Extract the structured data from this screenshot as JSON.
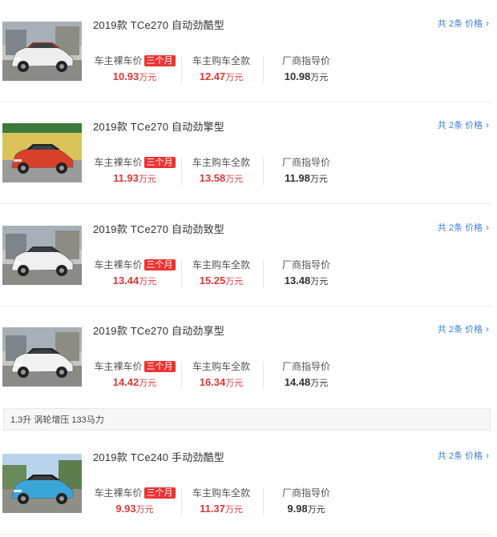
{
  "items": [
    {
      "title": "2019款 TCe270 自动劲酷型",
      "count": "共 2条 价格",
      "label_naked": "车主裸车价",
      "tag": "三个月",
      "naked": "10.93",
      "unit": "万元",
      "label_total": "车主购车全款",
      "total": "12.47",
      "label_guide": "厂商指导价",
      "guide": "10.98",
      "car_color": "#eeeeee",
      "roof_color": "#7a3a2a"
    },
    {
      "title": "2019款 TCe270 自动劲擎型",
      "count": "共 2条 价格",
      "label_naked": "车主裸车价",
      "tag": "三个月",
      "naked": "11.93",
      "unit": "万元",
      "label_total": "车主购车全款",
      "total": "13.58",
      "label_guide": "厂商指导价",
      "guide": "11.98",
      "car_color": "#d8402a",
      "roof_color": "#222222"
    },
    {
      "title": "2019款 TCe270 自动劲致型",
      "count": "共 2条 价格",
      "label_naked": "车主裸车价",
      "tag": "三个月",
      "naked": "13.44",
      "unit": "万元",
      "label_total": "车主购车全款",
      "total": "15.25",
      "label_guide": "厂商指导价",
      "guide": "13.48",
      "car_color": "#f0f0f0",
      "roof_color": "#333333"
    },
    {
      "title": "2019款 TCe270 自动劲享型",
      "count": "共 2条 价格",
      "label_naked": "车主裸车价",
      "tag": "三个月",
      "naked": "14.42",
      "unit": "万元",
      "label_total": "车主购车全款",
      "total": "16.34",
      "label_guide": "厂商指导价",
      "guide": "14.48",
      "car_color": "#f2f2f2",
      "roof_color": "#2a2a2a"
    },
    {
      "title": "2019款 TCe240 手动劲酷型",
      "count": "共 2条 价格",
      "label_naked": "车主裸车价",
      "tag": "三个月",
      "naked": "9.93",
      "unit": "万元",
      "label_total": "车主购车全款",
      "total": "11.37",
      "label_guide": "厂商指导价",
      "guide": "9.98",
      "car_color": "#3aa6d8",
      "roof_color": "#1e1e1e"
    }
  ],
  "spec_bar": "1.3升 涡轮增压 133马力",
  "colors": {
    "accent_blue": "#3a7fd5",
    "price_red": "#e03838",
    "tag_red": "#e33333"
  }
}
